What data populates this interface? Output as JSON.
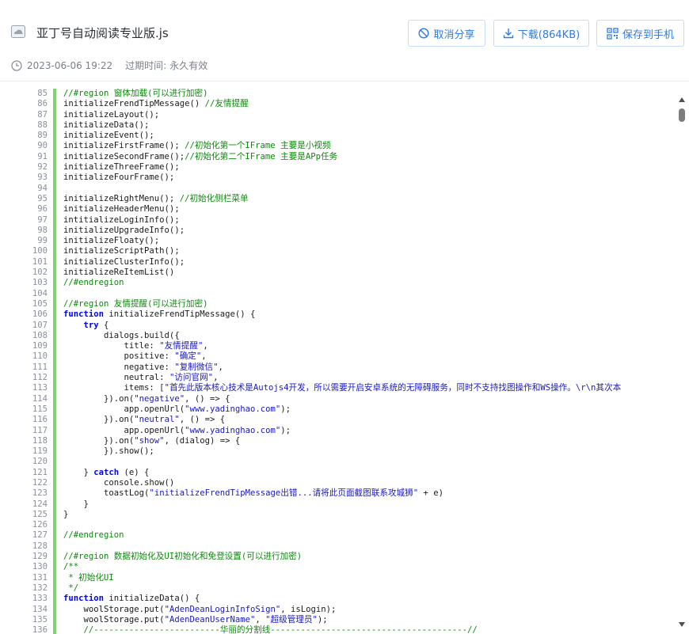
{
  "file": {
    "title": "亚丁号自动阅读专业版.js",
    "date": "2023-06-06 19:22",
    "expire_label": "过期时间:",
    "expire_value": "永久有效"
  },
  "buttons": {
    "cancel_share": "取消分享",
    "download": "下载(864KB)",
    "save_to_phone": "保存到手机"
  },
  "colors": {
    "accent": "#2f7ae5",
    "gutter_bar": "#7fd46e",
    "comment": "#0c8a0c",
    "keyword": "#0000ff",
    "string": "#1919c2"
  },
  "code_lines": [
    {
      "n": "85",
      "t": "//#region 窗体加载(可以进行加密)"
    },
    {
      "n": "86",
      "t": "initializeFrendTipMessage() //友情提醒"
    },
    {
      "n": "87",
      "t": "initializeLayout();"
    },
    {
      "n": "88",
      "t": "initializeData();"
    },
    {
      "n": "89",
      "t": "initializeEvent();"
    },
    {
      "n": "90",
      "t": "initializeFirstFrame(); //初始化第一个IFrame 主要是小视频"
    },
    {
      "n": "91",
      "t": "initializeSecondFrame();//初始化第二个IFrame 主要是APp任务"
    },
    {
      "n": "92",
      "t": "initializeThreeFrame();"
    },
    {
      "n": "93",
      "t": "initializeFourFrame();"
    },
    {
      "n": "94",
      "t": ""
    },
    {
      "n": "95",
      "t": "initializeRightMenu(); //初始化侧栏菜单"
    },
    {
      "n": "96",
      "t": "initializeHeaderMenu();"
    },
    {
      "n": "97",
      "t": "intitializeLoginInfo();"
    },
    {
      "n": "98",
      "t": "initializeUpgradeInfo();"
    },
    {
      "n": "99",
      "t": "initializeFloaty();"
    },
    {
      "n": "100",
      "t": "initializeScriptPath();"
    },
    {
      "n": "101",
      "t": "initializeClusterInfo();"
    },
    {
      "n": "102",
      "t": "initializeReItemList()"
    },
    {
      "n": "103",
      "t": "//#endregion"
    },
    {
      "n": "104",
      "t": ""
    },
    {
      "n": "105",
      "t": "//#region 友情提醒(可以进行加密)"
    },
    {
      "n": "106",
      "t": "function initializeFrendTipMessage() {"
    },
    {
      "n": "107",
      "t": "    try {"
    },
    {
      "n": "108",
      "t": "        dialogs.build({"
    },
    {
      "n": "109",
      "t": "            title: \"友情提醒\","
    },
    {
      "n": "110",
      "t": "            positive: \"确定\","
    },
    {
      "n": "111",
      "t": "            negative: \"复制微信\","
    },
    {
      "n": "112",
      "t": "            neutral: \"访问官网\","
    },
    {
      "n": "113",
      "t": "            items: [\"首先此版本核心技术是Autojs4开发，所以需要开启安卓系统的无障碍服务，同时不支持找图操作和WS操作。\\r\\n其次本"
    },
    {
      "n": "114",
      "t": "        }).on(\"negative\", () => {"
    },
    {
      "n": "115",
      "t": "            app.openUrl(\"www.yadinghao.com\");"
    },
    {
      "n": "116",
      "t": "        }).on(\"neutral\", () => {"
    },
    {
      "n": "117",
      "t": "            app.openUrl(\"www.yadinghao.com\");"
    },
    {
      "n": "118",
      "t": "        }).on(\"show\", (dialog) => {"
    },
    {
      "n": "119",
      "t": "        }).show();"
    },
    {
      "n": "120",
      "t": ""
    },
    {
      "n": "121",
      "t": "    } catch (e) {"
    },
    {
      "n": "122",
      "t": "        console.show()"
    },
    {
      "n": "123",
      "t": "        toastLog(\"initializeFrendTipMessage出错...请将此页面截图联系攻城狮\" + e)"
    },
    {
      "n": "124",
      "t": "    }"
    },
    {
      "n": "125",
      "t": "}"
    },
    {
      "n": "126",
      "t": ""
    },
    {
      "n": "127",
      "t": "//#endregion"
    },
    {
      "n": "128",
      "t": ""
    },
    {
      "n": "129",
      "t": "//#region 数据初始化及UI初始化和免登设置(可以进行加密)"
    },
    {
      "n": "130",
      "t": "/**"
    },
    {
      "n": "131",
      "t": " * 初始化UI"
    },
    {
      "n": "132",
      "t": " */"
    },
    {
      "n": "133",
      "t": "function initializeData() {"
    },
    {
      "n": "134",
      "t": "    woolStorage.put(\"AdenDeanLoginInfoSign\", isLogin);"
    },
    {
      "n": "135",
      "t": "    woolStorage.put(\"AdenDeanUserName\", \"超级管理员\");"
    },
    {
      "n": "136",
      "t": "    //-------------------------华丽的分割线---------------------------------------//"
    }
  ]
}
